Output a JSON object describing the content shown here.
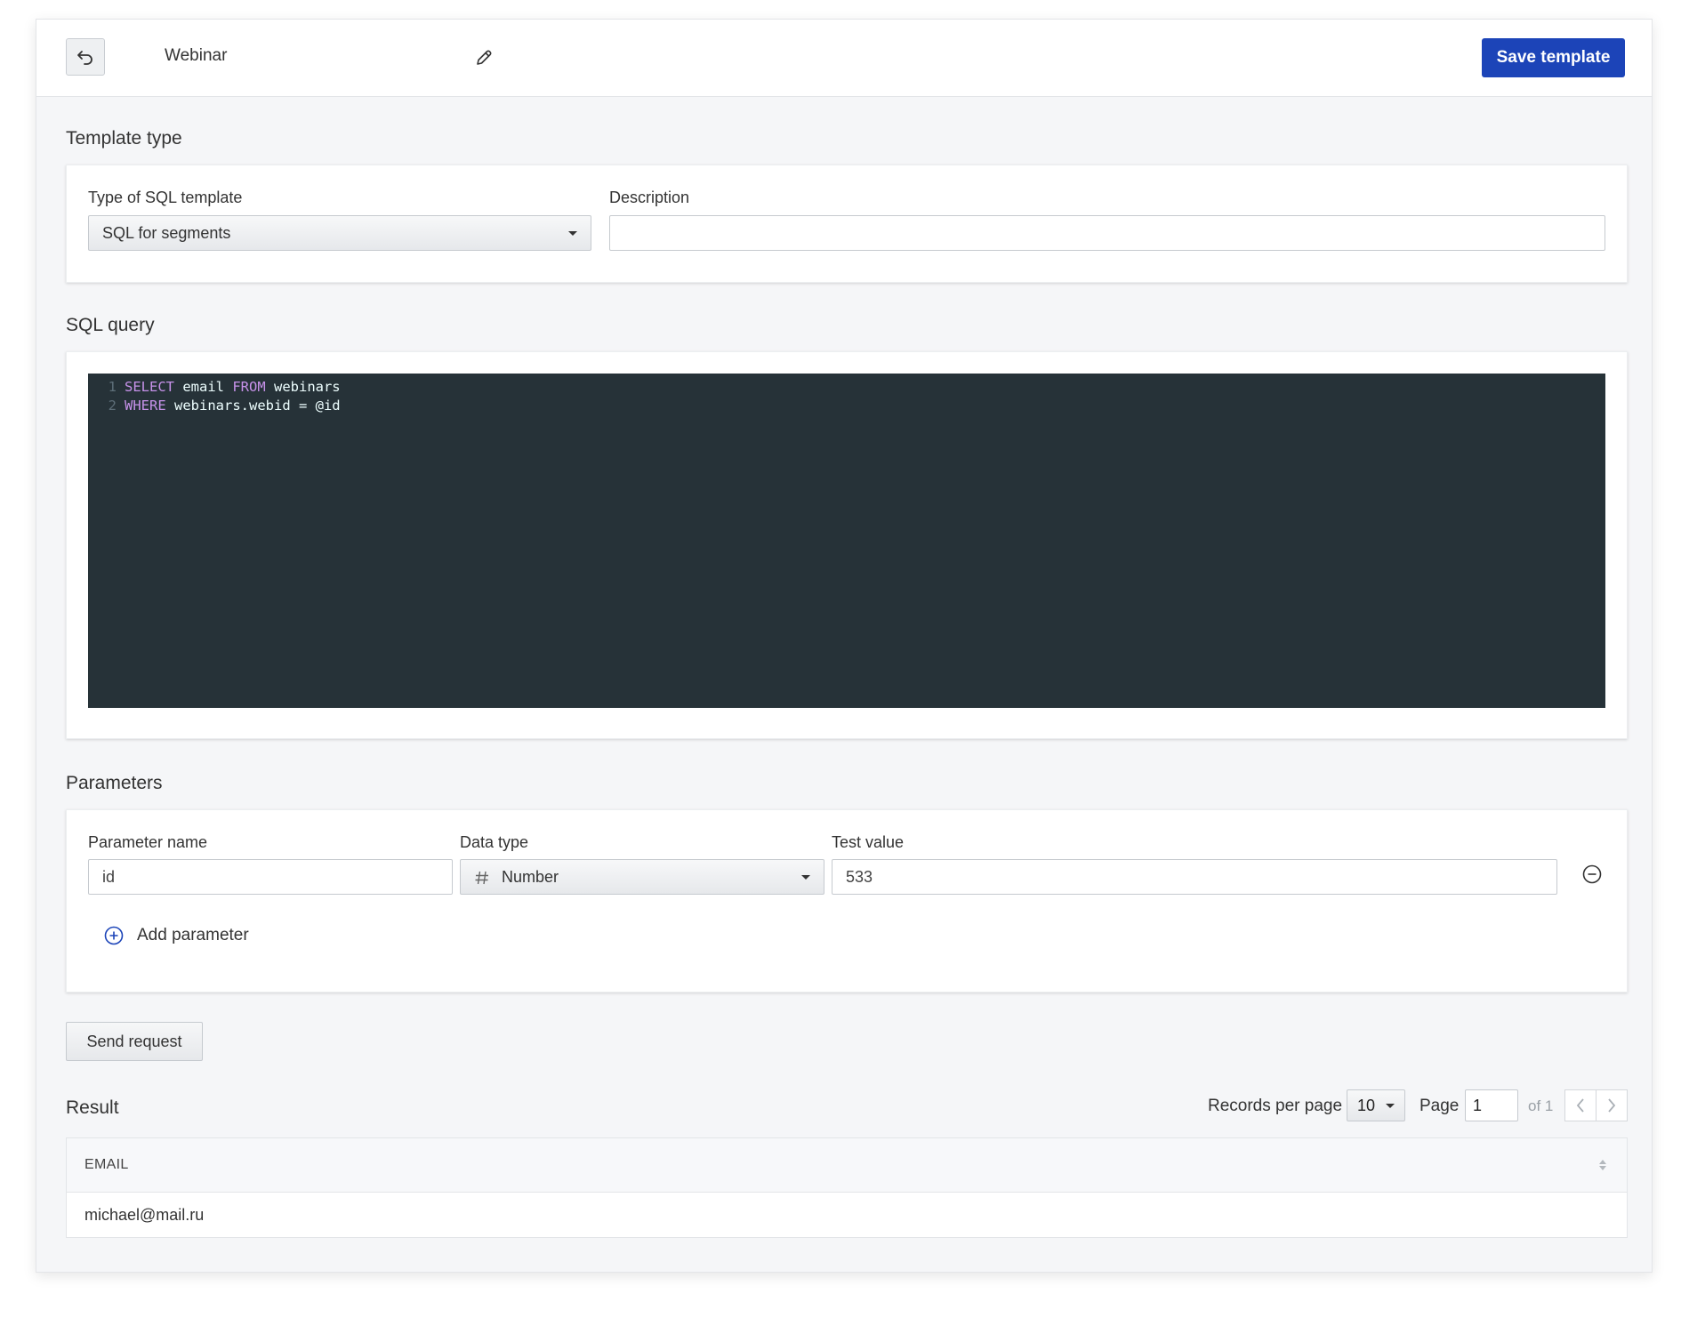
{
  "header": {
    "title": "Webinar",
    "save_label": "Save template"
  },
  "template_type": {
    "section_title": "Template type",
    "type_label": "Type of SQL template",
    "type_value": "SQL for segments",
    "description_label": "Description",
    "description_value": ""
  },
  "sql_query": {
    "section_title": "SQL query",
    "lines": [
      {
        "num": "1",
        "tokens": [
          {
            "t": "SELECT",
            "k": "kw"
          },
          {
            "t": " email ",
            "k": "tx"
          },
          {
            "t": "FROM",
            "k": "kw"
          },
          {
            "t": " webinars",
            "k": "tx"
          }
        ]
      },
      {
        "num": "2",
        "tokens": [
          {
            "t": "WHERE",
            "k": "kw"
          },
          {
            "t": " webinars.webid = @id",
            "k": "tx"
          }
        ]
      }
    ]
  },
  "parameters": {
    "section_title": "Parameters",
    "name_label": "Parameter name",
    "type_label": "Data type",
    "test_label": "Test value",
    "rows": [
      {
        "name": "id",
        "type_icon": "hash-icon",
        "type": "Number",
        "test_value": "533"
      }
    ],
    "add_label": "Add parameter"
  },
  "send_label": "Send request",
  "result": {
    "section_title": "Result",
    "records_per_page_label": "Records per page",
    "records_per_page_value": "10",
    "page_label": "Page",
    "page_value": "1",
    "of_label": "of 1",
    "columns": [
      "EMAIL"
    ],
    "rows": [
      [
        "michael@mail.ru"
      ]
    ]
  },
  "colors": {
    "accent": "#1c44b8",
    "editor_bg": "#263238",
    "keyword": "#c792ea"
  }
}
